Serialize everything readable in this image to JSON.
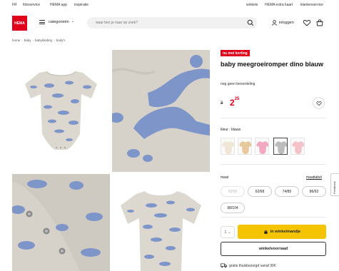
{
  "topnav": {
    "left": [
      "FR",
      "fotoservice",
      "HEMA app",
      "inspiratie"
    ],
    "right": [
      "winkels",
      "HEMA extra kaart",
      "klantenservice"
    ]
  },
  "header": {
    "logo": "HEMA",
    "categories_label": "categorieën",
    "search_placeholder": "waar ben je naar op zoek?",
    "login_label": "inloggen"
  },
  "breadcrumb": [
    "home",
    "baby",
    "babykleding",
    "body's"
  ],
  "product": {
    "badge": "nu met korting",
    "title": "baby meegroeiromper dino blauw",
    "review": "nog geen beoordeling",
    "old_price": "3",
    "price_main": "2",
    "price_cents": "25",
    "color_label": "kleur : blauw",
    "swatch_colors": [
      "#efe6d6",
      "#e8c99c",
      "#f3a9c4",
      "#bcbcbc",
      "#f4c3c7"
    ],
    "selected_swatch": 3,
    "size_label": "maat",
    "size_table": "maattabel",
    "sizes": [
      {
        "label": "50/56",
        "available": false
      },
      {
        "label": "62/68",
        "available": true
      },
      {
        "label": "74/80",
        "available": true
      },
      {
        "label": "86/92",
        "available": true
      },
      {
        "label": "98/104",
        "available": true
      }
    ],
    "qty": "1",
    "cart_button": "in winkelmandje",
    "store_button": "winkelvoorraad",
    "shipping": "gratis thuisbezorgd vanaf 30€"
  },
  "feedback": "Feedback",
  "colors": {
    "brand_red": "#e0001b",
    "cart_yellow": "#f5c400",
    "dino_blue": "#7e95c9",
    "fabric_grey": "#d8d4cc"
  }
}
